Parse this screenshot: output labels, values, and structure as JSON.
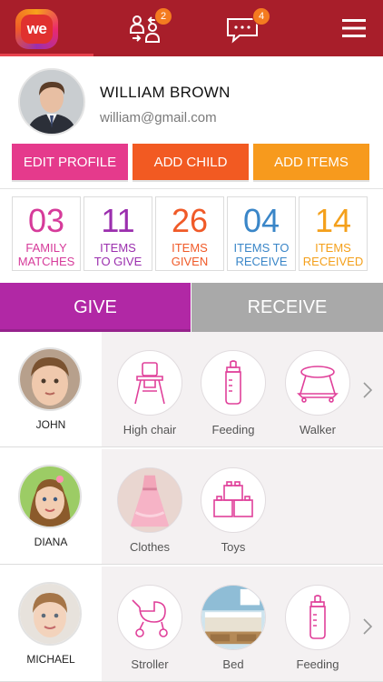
{
  "header": {
    "logo_text": "we",
    "matches_badge": "2",
    "messages_badge": "4",
    "accent": "#a81e2a"
  },
  "profile": {
    "name": "WILLIAM BROWN",
    "email": "william@gmail.com"
  },
  "actions": {
    "edit_profile": "EDIT PROFILE",
    "add_child": "ADD CHILD",
    "add_items": "ADD  ITEMS"
  },
  "stats": [
    {
      "value": "03",
      "line1": "FAMILY",
      "line2": "MATCHES",
      "color": "#d63b9a"
    },
    {
      "value": "11",
      "line1": "ITEMS",
      "line2": "TO GIVE",
      "color": "#9b2fae"
    },
    {
      "value": "26",
      "line1": "ITEMS",
      "line2": "GIVEN",
      "color": "#f05a28"
    },
    {
      "value": "04",
      "line1": "ITEMS TO",
      "line2": "RECEIVE",
      "color": "#3a86c8"
    },
    {
      "value": "14",
      "line1": "ITEMS",
      "line2": "RECEIVED",
      "color": "#f4a01b"
    }
  ],
  "tabs": {
    "give": "GIVE",
    "receive": "RECEIVE"
  },
  "children": [
    {
      "name": "JOHN",
      "items": [
        "High chair",
        "Feeding",
        "Walker"
      ],
      "icons": [
        "high-chair-icon",
        "feeding-bottle-icon",
        "walker-icon"
      ]
    },
    {
      "name": "DIANA",
      "items": [
        "Clothes",
        "Toys"
      ],
      "icons": [
        "dress-photo",
        "toy-blocks-icon"
      ]
    },
    {
      "name": "MICHAEL",
      "items": [
        "Stroller",
        "Bed",
        "Feeding"
      ],
      "icons": [
        "stroller-icon",
        "bed-photo",
        "feeding-bottle-icon"
      ]
    }
  ]
}
